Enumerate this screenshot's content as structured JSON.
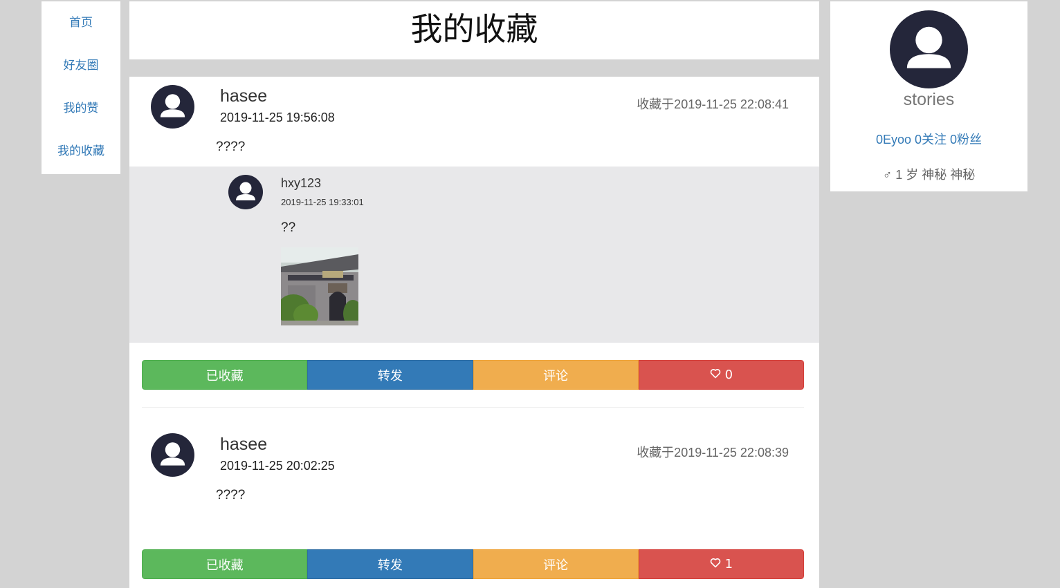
{
  "nav": {
    "items": [
      {
        "label": "首页"
      },
      {
        "label": "好友圈"
      },
      {
        "label": "我的赞"
      },
      {
        "label": "我的收藏"
      }
    ]
  },
  "page": {
    "title": "我的收藏"
  },
  "colors": {
    "background": "#d3d3d3",
    "link": "#337ab7",
    "avatar": "#24263a",
    "repost_bg": "#e8e8ea",
    "btn_collected": "#5cb85c",
    "btn_forward": "#337ab7",
    "btn_comment": "#f0ad4e",
    "btn_like": "#d9534f"
  },
  "posts": [
    {
      "user": "hasee",
      "time": "2019-11-25 19:56:08",
      "fav_time": "收藏于2019-11-25 22:08:41",
      "text": "????",
      "repost": {
        "user": "hxy123",
        "time": "2019-11-25 19:33:01",
        "text": "??"
      },
      "buttons": {
        "collected": "已收藏",
        "forward": "转发",
        "comment": "评论",
        "likes": "0"
      }
    },
    {
      "user": "hasee",
      "time": "2019-11-25 20:02:25",
      "fav_time": "收藏于2019-11-25 22:08:39",
      "text": "????",
      "buttons": {
        "collected": "已收藏",
        "forward": "转发",
        "comment": "评论",
        "likes": "1"
      }
    }
  ],
  "profile": {
    "name": "stories",
    "eyoo": "0Eyoo",
    "following": "0关注",
    "followers": "0粉丝",
    "gender_icon": "male-icon",
    "age": "1 岁",
    "region1": "神秘",
    "region2": "神秘"
  }
}
